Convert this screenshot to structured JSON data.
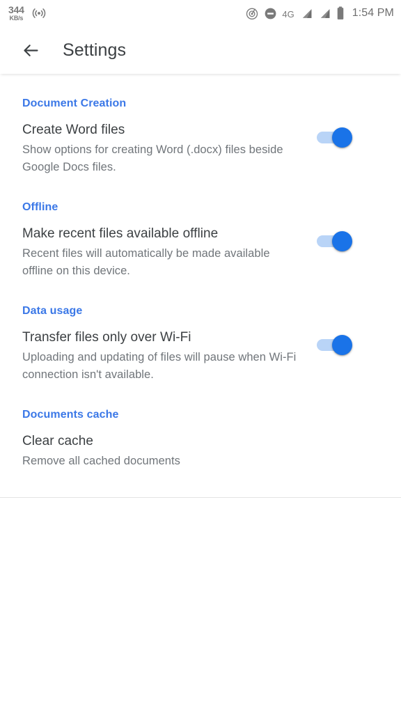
{
  "status_bar": {
    "network_speed_value": "344",
    "network_speed_unit": "KB/s",
    "broadcast_icon": "broadcast-icon",
    "hotspot_icon": "hotspot-icon",
    "do_not_disturb_icon": "do-not-disturb-icon",
    "network_type": "4G",
    "signal_icon_1": "signal-bars-icon",
    "signal_icon_2": "signal-bars-icon",
    "battery_icon": "battery-icon",
    "time": "1:54 PM"
  },
  "app_bar": {
    "back_icon": "back-arrow-icon",
    "title": "Settings"
  },
  "colors": {
    "section_header": "#3b78e7",
    "switch_thumb_on": "#1a73e8",
    "switch_track_on": "#b9d4f7",
    "title_text": "#3c4043",
    "summary_text": "#70757a"
  },
  "sections": [
    {
      "header": "Document Creation",
      "items": [
        {
          "title": "Create Word files",
          "summary": "Show options for creating Word (.docx) files beside Google Docs files.",
          "has_switch": true,
          "switch_state": "on"
        }
      ]
    },
    {
      "header": "Offline",
      "items": [
        {
          "title": "Make recent files available offline",
          "summary": "Recent files will automatically be made available offline on this device.",
          "has_switch": true,
          "switch_state": "on"
        }
      ]
    },
    {
      "header": "Data usage",
      "items": [
        {
          "title": "Transfer files only over Wi-Fi",
          "summary": "Uploading and updating of files will pause when Wi-Fi connection isn't available.",
          "has_switch": true,
          "switch_state": "on"
        }
      ]
    },
    {
      "header": "Documents cache",
      "items": [
        {
          "title": "Clear cache",
          "summary": "Remove all cached documents",
          "has_switch": false,
          "switch_state": ""
        }
      ]
    }
  ]
}
